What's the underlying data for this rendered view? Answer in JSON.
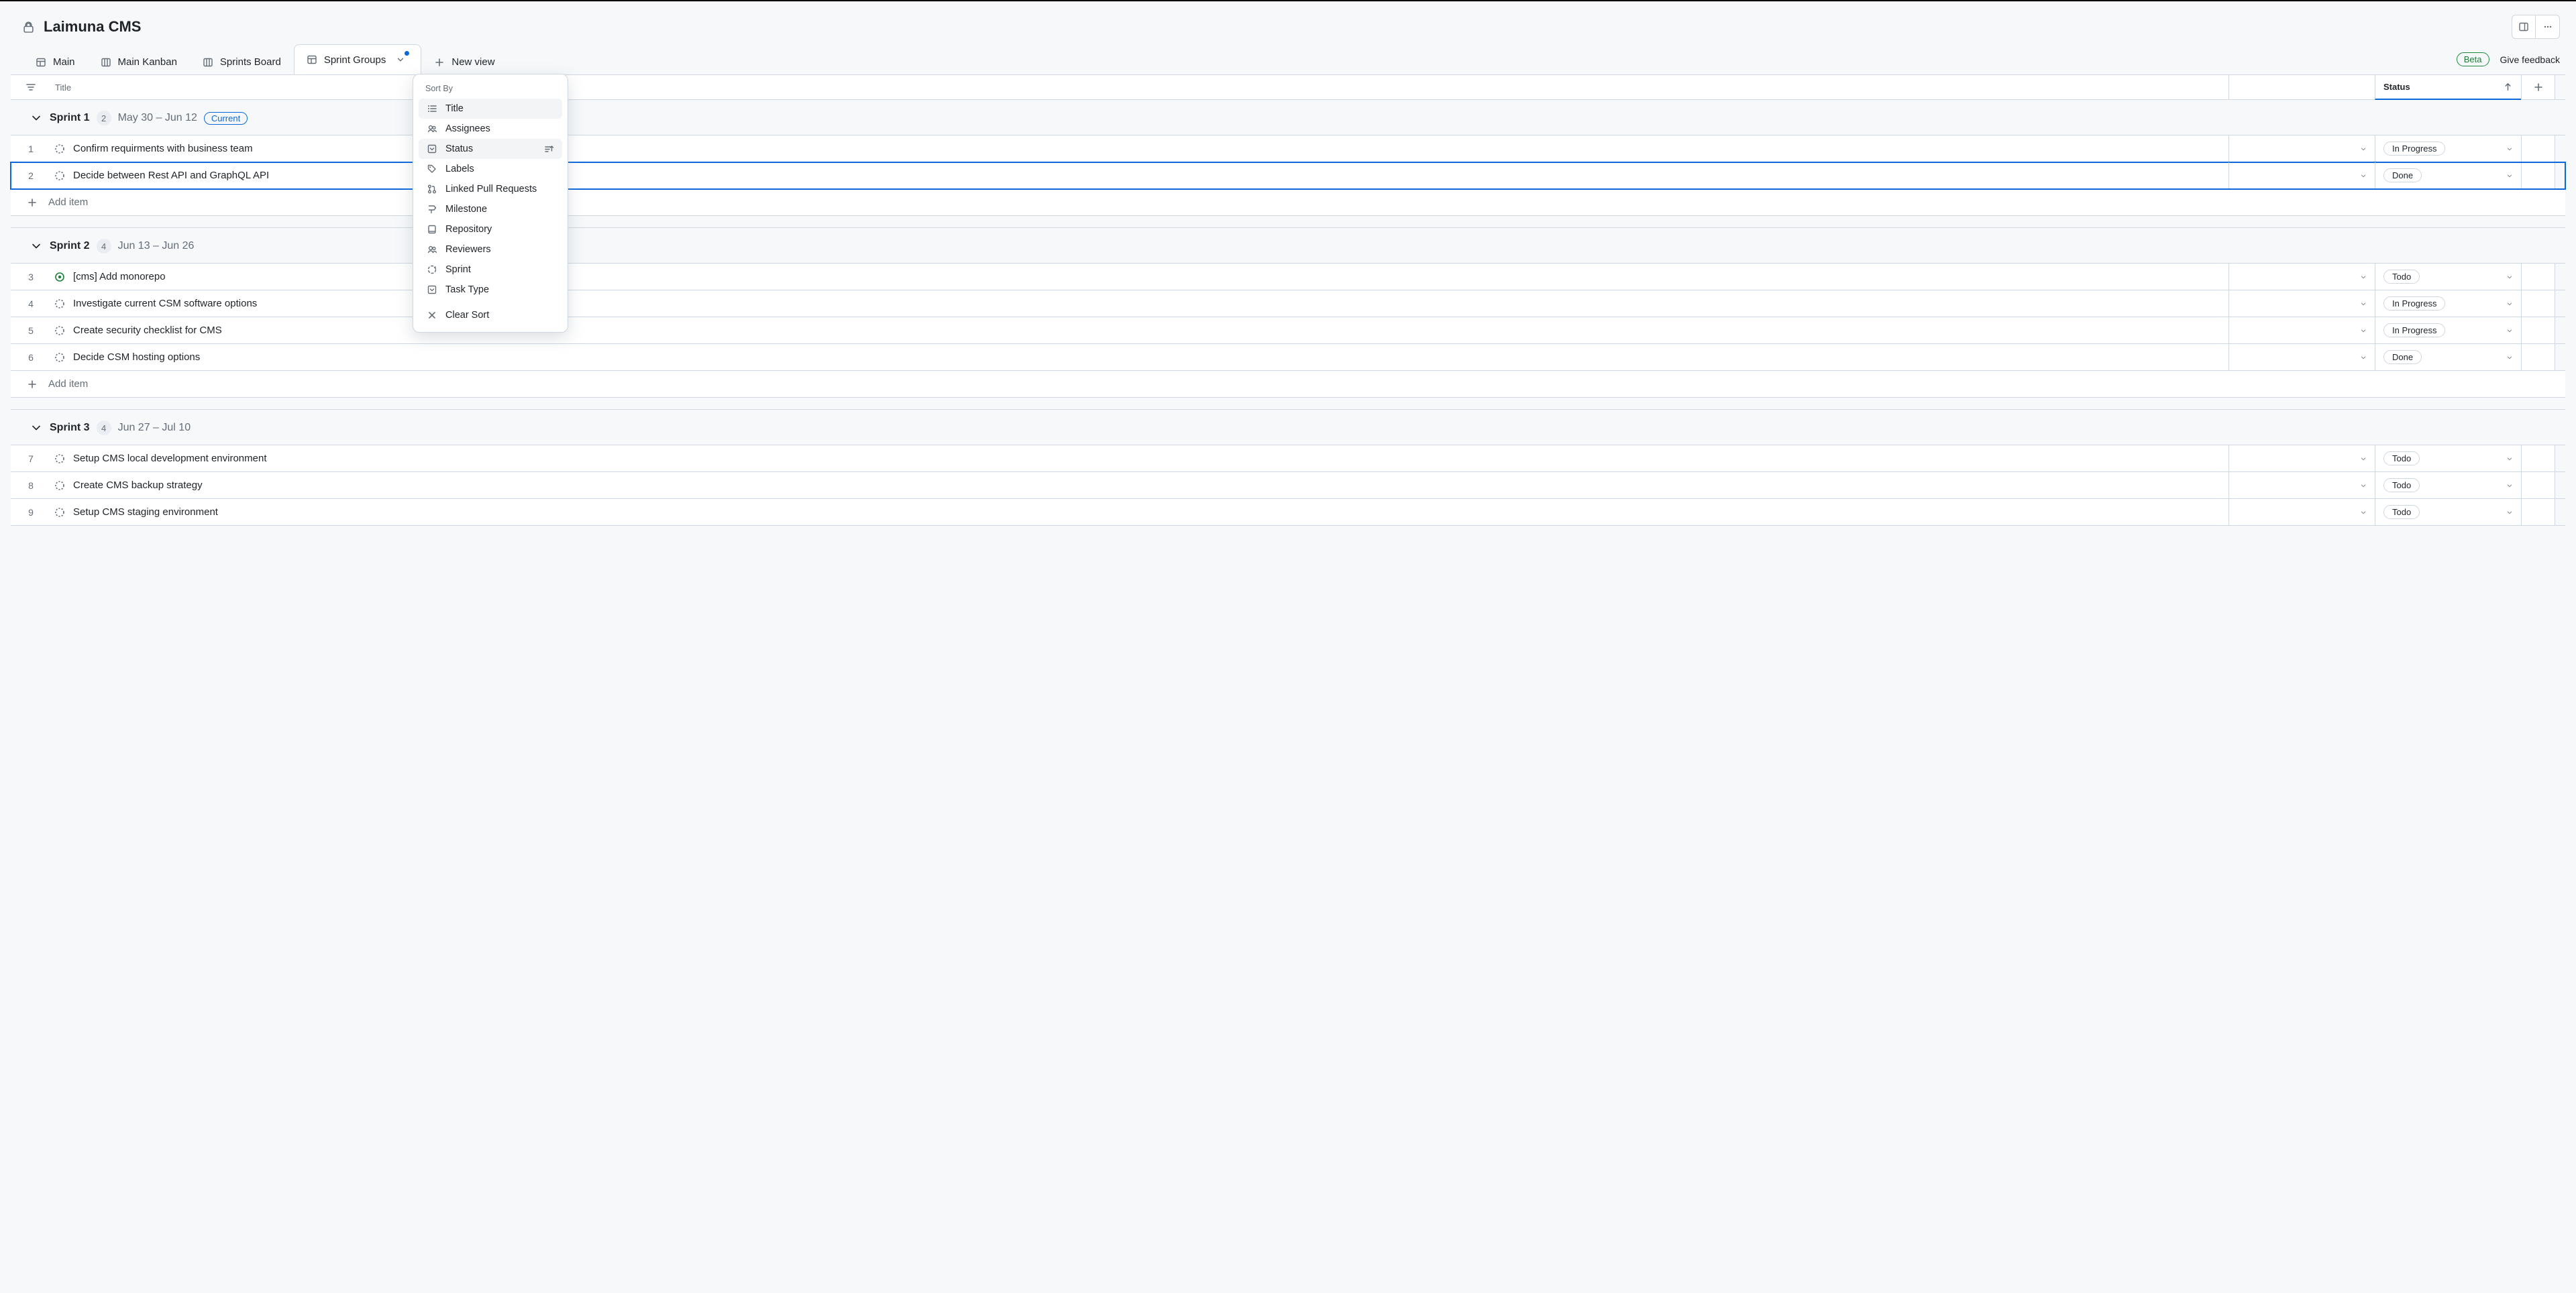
{
  "header": {
    "title": "Laimuna CMS"
  },
  "tabs": [
    {
      "label": "Main",
      "icon": "table"
    },
    {
      "label": "Main Kanban",
      "icon": "board"
    },
    {
      "label": "Sprints Board",
      "icon": "board"
    },
    {
      "label": "Sprint Groups",
      "icon": "table",
      "active": true,
      "dirty": true
    }
  ],
  "new_view": "New view",
  "beta": "Beta",
  "feedback": "Give feedback",
  "columns": {
    "title": "Title",
    "status": "Status"
  },
  "popover": {
    "heading": "Sort By",
    "items": [
      {
        "label": "Title",
        "icon": "list"
      },
      {
        "label": "Assignees",
        "icon": "people"
      },
      {
        "label": "Status",
        "icon": "select",
        "active_sort": true
      },
      {
        "label": "Labels",
        "icon": "tag"
      },
      {
        "label": "Linked Pull Requests",
        "icon": "pr"
      },
      {
        "label": "Milestone",
        "icon": "milestone"
      },
      {
        "label": "Repository",
        "icon": "repo"
      },
      {
        "label": "Reviewers",
        "icon": "people"
      },
      {
        "label": "Sprint",
        "icon": "sprint"
      },
      {
        "label": "Task Type",
        "icon": "select"
      }
    ],
    "clear": "Clear Sort"
  },
  "add_item": "Add item",
  "groups": [
    {
      "name": "Sprint 1",
      "count": "2",
      "dates": "May 30 – Jun 12",
      "current": true,
      "current_label": "Current",
      "rows": [
        {
          "n": "1",
          "kind": "draft",
          "title": "Confirm requirments with business team",
          "status": "In Progress"
        },
        {
          "n": "2",
          "kind": "draft",
          "title": "Decide between Rest API and GraphQL API",
          "status": "Done",
          "selected": true
        }
      ]
    },
    {
      "name": "Sprint 2",
      "count": "4",
      "dates": "Jun 13 – Jun 26",
      "rows": [
        {
          "n": "3",
          "kind": "open",
          "title": "[cms] Add monorepo",
          "status": "Todo"
        },
        {
          "n": "4",
          "kind": "draft",
          "title": "Investigate current CSM software options",
          "status": "In Progress"
        },
        {
          "n": "5",
          "kind": "draft",
          "title": "Create security checklist for CMS",
          "status": "In Progress"
        },
        {
          "n": "6",
          "kind": "draft",
          "title": "Decide CSM hosting options",
          "status": "Done"
        }
      ]
    },
    {
      "name": "Sprint 3",
      "count": "4",
      "dates": "Jun 27 – Jul 10",
      "rows": [
        {
          "n": "7",
          "kind": "draft",
          "title": "Setup CMS local development environment",
          "status": "Todo"
        },
        {
          "n": "8",
          "kind": "draft",
          "title": "Create CMS backup strategy",
          "status": "Todo"
        },
        {
          "n": "9",
          "kind": "draft",
          "title": "Setup CMS staging environment",
          "status": "Todo"
        }
      ],
      "no_add": true
    }
  ]
}
